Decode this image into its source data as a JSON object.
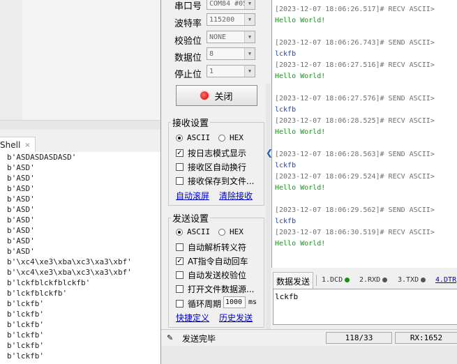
{
  "shell": {
    "tab_label": "Shell",
    "tab_close": "×",
    "lines": [
      "b'ASDASDASDASD'",
      "b'ASD'",
      "b'ASD'",
      "b'ASD'",
      "b'ASD'",
      "b'ASD'",
      "b'ASD'",
      "b'ASD'",
      "b'ASD'",
      "b'ASD'",
      "b'\\xc4\\xe3\\xba\\xc3\\xa3\\xbf'",
      "b'\\xc4\\xe3\\xba\\xc3\\xa3\\xbf'",
      "b'lckfblckfblckfb'",
      "b'lckfblckfb'",
      "b'lckfb'",
      "b'lckfb'",
      "b'lckfb'",
      "b'lckfb'",
      "b'lckfb'",
      "b'lckfb'"
    ]
  },
  "serial": {
    "port": {
      "label": "串口号",
      "value": "COM84 #05"
    },
    "baud": {
      "label": "波特率",
      "value": "115200"
    },
    "parity": {
      "label": "校验位",
      "value": "NONE"
    },
    "databits": {
      "label": "数据位",
      "value": "8"
    },
    "stopbits": {
      "label": "停止位",
      "value": "1"
    },
    "close_button": "关闭"
  },
  "recv_settings": {
    "title": "接收设置",
    "ascii": "ASCII",
    "hex": "HEX",
    "options": [
      "按日志模式显示",
      "接收区自动换行",
      "接收保存到文件..."
    ],
    "checked": [
      true,
      false,
      false
    ],
    "links": [
      "自动滚屏",
      "清除接收"
    ]
  },
  "send_settings": {
    "title": "发送设置",
    "ascii": "ASCII",
    "hex": "HEX",
    "options": [
      "自动解析转义符",
      "AT指令自动回车",
      "自动发送校验位",
      "打开文件数据源..."
    ],
    "checked": [
      false,
      true,
      false,
      false
    ],
    "cycle_label": "循环周期",
    "cycle_value": "1000",
    "cycle_unit": "ms",
    "links": [
      "快捷定义",
      "历史发送"
    ]
  },
  "recv_log": [
    {
      "t": "[2023-12-07 18:06:26.517]# RECV ASCII>",
      "c": "meta"
    },
    {
      "t": "Hello World!",
      "c": "green"
    },
    {
      "t": "",
      "c": "meta"
    },
    {
      "t": "[2023-12-07 18:06:26.743]# SEND ASCII>",
      "c": "meta"
    },
    {
      "t": "lckfb",
      "c": "blue"
    },
    {
      "t": "[2023-12-07 18:06:27.516]# RECV ASCII>",
      "c": "meta"
    },
    {
      "t": "Hello World!",
      "c": "green"
    },
    {
      "t": "",
      "c": "meta"
    },
    {
      "t": "[2023-12-07 18:06:27.576]# SEND ASCII>",
      "c": "meta"
    },
    {
      "t": "lckfb",
      "c": "blue"
    },
    {
      "t": "[2023-12-07 18:06:28.525]# RECV ASCII>",
      "c": "meta"
    },
    {
      "t": "Hello World!",
      "c": "green"
    },
    {
      "t": "",
      "c": "meta"
    },
    {
      "t": "[2023-12-07 18:06:28.563]# SEND ASCII>",
      "c": "meta"
    },
    {
      "t": "lckfb",
      "c": "blue"
    },
    {
      "t": "[2023-12-07 18:06:29.524]# RECV ASCII>",
      "c": "meta"
    },
    {
      "t": "Hello World!",
      "c": "green"
    },
    {
      "t": "",
      "c": "meta"
    },
    {
      "t": "[2023-12-07 18:06:29.562]# SEND ASCII>",
      "c": "meta"
    },
    {
      "t": "lckfb",
      "c": "blue"
    },
    {
      "t": "[2023-12-07 18:06:30.519]# RECV ASCII>",
      "c": "meta"
    },
    {
      "t": "Hello World!",
      "c": "green"
    }
  ],
  "send_panel": {
    "tab": "数据发送",
    "dcd": "1.DCD",
    "rxd": "2.RXD",
    "txd": "3.TXD",
    "dtr": "4.DTR",
    "text": "lckfb"
  },
  "status": {
    "message": "发送完毕",
    "counter": "118/33",
    "rx": "RX:1652"
  },
  "colors": {
    "green": "#119a11",
    "blue": "#1f3fbf",
    "dcd_dot": "#1a8c1a",
    "rxd_dot": "#555555",
    "txd_dot": "#555555"
  }
}
